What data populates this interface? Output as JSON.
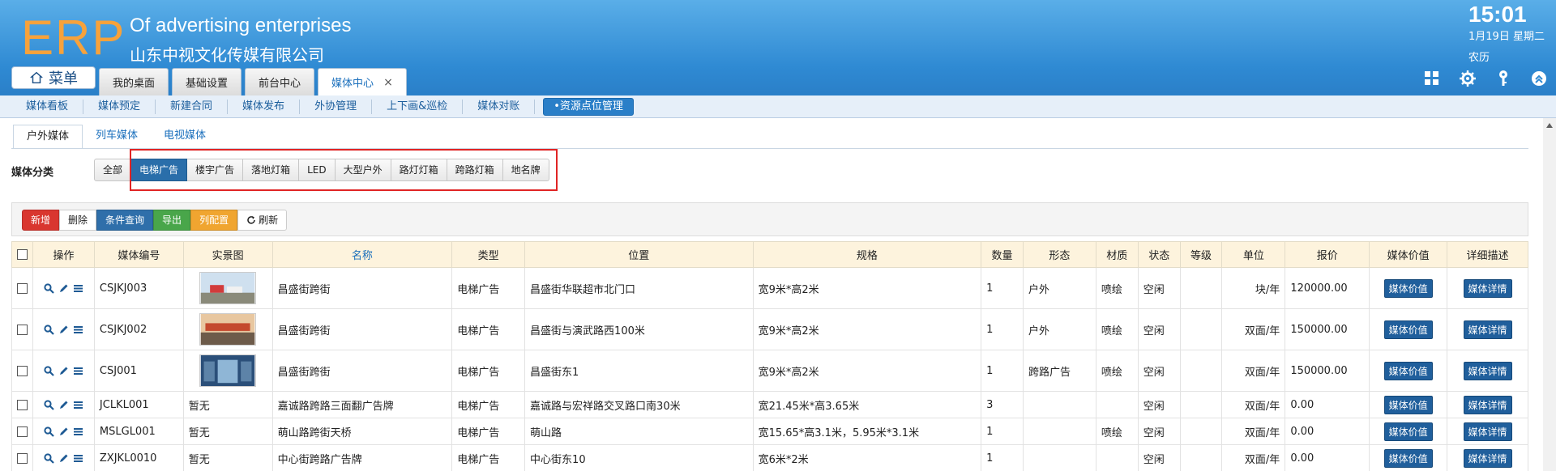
{
  "header": {
    "logo": "ERP",
    "brand_en": "Of advertising enterprises",
    "brand_cn": "山东中视文化传媒有限公司",
    "clock": "15:01",
    "date": "1月19日 星期二",
    "lunar": "农历",
    "menu_label": "菜单",
    "tabs": [
      {
        "label": "我的桌面"
      },
      {
        "label": "基础设置"
      },
      {
        "label": "前台中心"
      },
      {
        "label": "媒体中心",
        "close": "×"
      }
    ]
  },
  "subnav": [
    "媒体看板",
    "媒体预定",
    "新建合同",
    "媒体发布",
    "外协管理",
    "上下画&巡检",
    "媒体对账",
    "•资源点位管理"
  ],
  "media_tabs": [
    "户外媒体",
    "列车媒体",
    "电视媒体"
  ],
  "category": {
    "label": "媒体分类",
    "buttons": [
      "全部",
      "电梯广告",
      "楼宇广告",
      "落地灯箱",
      "LED",
      "大型户外",
      "路灯灯箱",
      "跨路灯箱",
      "地名牌"
    ],
    "active_index": 1
  },
  "toolbar": {
    "add": "新增",
    "delete": "删除",
    "query": "条件查询",
    "export": "导出",
    "columns": "列配置",
    "refresh": "刷新"
  },
  "table": {
    "headers": [
      "操作",
      "媒体编号",
      "实景图",
      "名称",
      "类型",
      "位置",
      "规格",
      "数量",
      "形态",
      "材质",
      "状态",
      "等级",
      "单位",
      "报价",
      "媒体价值",
      "详细描述"
    ],
    "value_btn": "媒体价值",
    "detail_btn": "媒体详情",
    "rows": [
      {
        "code": "CSJKJ003",
        "img": "",
        "name": "昌盛街跨街",
        "type": "电梯广告",
        "loc": "昌盛街华联超市北门口",
        "spec": "宽9米*高2米",
        "qty": "1",
        "form": "户外",
        "mat": "喷绘",
        "status": "空闲",
        "grade": "",
        "unit": "块/年",
        "price": "120000.00"
      },
      {
        "code": "CSJKJ002",
        "img": "",
        "name": "昌盛街跨街",
        "type": "电梯广告",
        "loc": "昌盛街与演武路西100米",
        "spec": "宽9米*高2米",
        "qty": "1",
        "form": "户外",
        "mat": "喷绘",
        "status": "空闲",
        "grade": "",
        "unit": "双面/年",
        "price": "150000.00"
      },
      {
        "code": "CSJ001",
        "img": "",
        "name": "昌盛街跨街",
        "type": "电梯广告",
        "loc": "昌盛街东1",
        "spec": "宽9米*高2米",
        "qty": "1",
        "form": "跨路广告",
        "mat": "喷绘",
        "status": "空闲",
        "grade": "",
        "unit": "双面/年",
        "price": "150000.00"
      },
      {
        "code": "JCLKL001",
        "img": "暂无",
        "name": "嘉诚路跨路三面翻广告牌",
        "type": "电梯广告",
        "loc": "嘉诚路与宏祥路交叉路口南30米",
        "spec": "宽21.45米*高3.65米",
        "qty": "3",
        "form": "",
        "mat": "",
        "status": "空闲",
        "grade": "",
        "unit": "双面/年",
        "price": "0.00"
      },
      {
        "code": "MSLGL001",
        "img": "暂无",
        "name": "萌山路跨街天桥",
        "type": "电梯广告",
        "loc": "萌山路",
        "spec": "宽15.65*高3.1米，5.95米*3.1米",
        "qty": "1",
        "form": "",
        "mat": "喷绘",
        "status": "空闲",
        "grade": "",
        "unit": "双面/年",
        "price": "0.00"
      },
      {
        "code": "ZXJKL0010",
        "img": "暂无",
        "name": "中心街跨路广告牌",
        "type": "电梯广告",
        "loc": "中心街东10",
        "spec": "宽6米*2米",
        "qty": "1",
        "form": "",
        "mat": "",
        "status": "空闲",
        "grade": "",
        "unit": "双面/年",
        "price": "0.00"
      }
    ]
  },
  "colors": {
    "header_blue": "#2f8ad3",
    "logo_orange": "#f7a23b",
    "highlight_red": "#e02424",
    "btn_blue": "#205f9c"
  },
  "icons": [
    "home-icon",
    "grid-icon",
    "gear-icon",
    "key-icon",
    "collapse-icon",
    "search-icon",
    "edit-icon",
    "list-icon",
    "refresh-icon"
  ]
}
